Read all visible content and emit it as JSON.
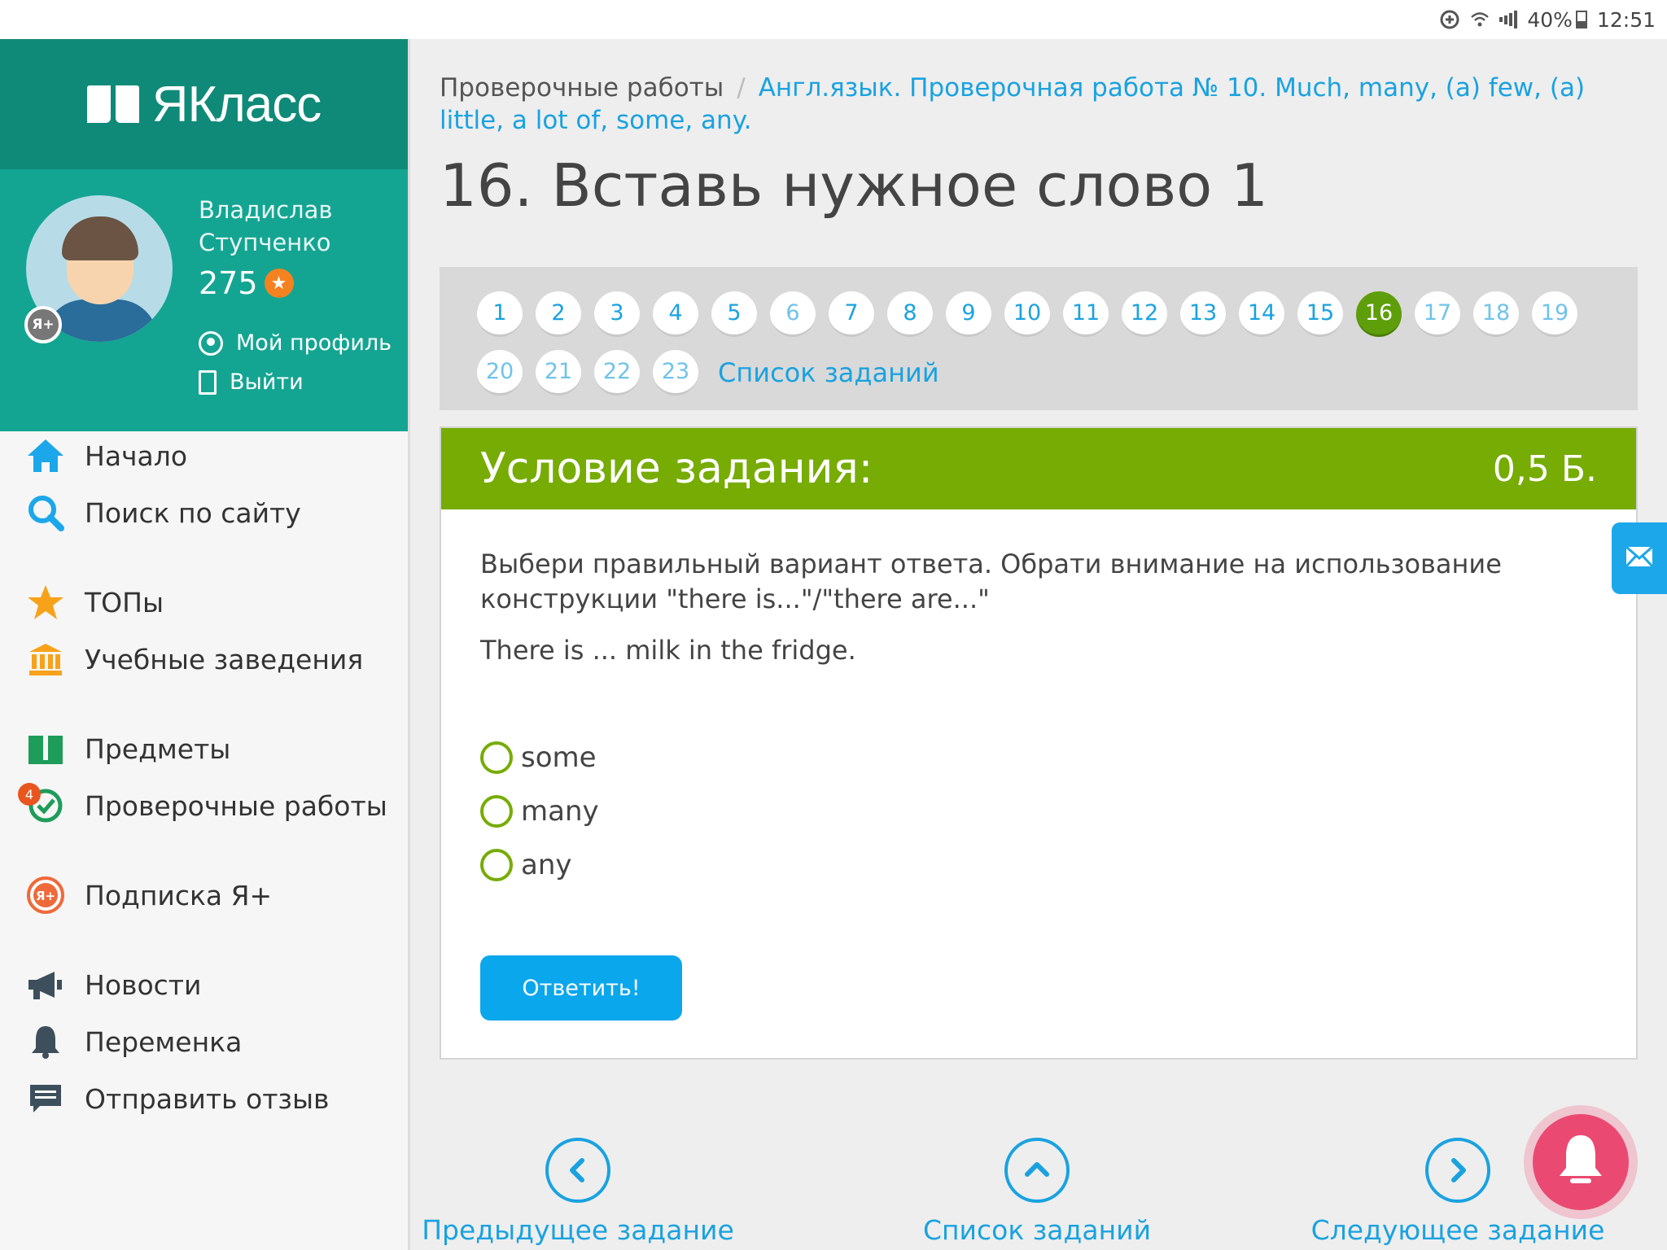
{
  "statusbar": {
    "battery": "40%",
    "time": "12:51"
  },
  "brand": {
    "name": "ЯКласс"
  },
  "profile": {
    "name": "Владислав Ступченко",
    "points": "275",
    "plus_badge": "Я+",
    "my_profile": "Мой профиль",
    "logout": "Выйти"
  },
  "nav": {
    "home": "Начало",
    "search": "Поиск по сайту",
    "tops": "ТОПы",
    "schools": "Учебные заведения",
    "subjects": "Предметы",
    "tests": "Проверочные работы",
    "tests_count": "4",
    "subscription": "Подписка Я+",
    "news": "Новости",
    "break": "Переменка",
    "feedback": "Отправить отзыв"
  },
  "breadcrumb": {
    "root": "Проверочные работы",
    "sep": "/",
    "current": "Англ.язык. Проверочная работа № 10. Much, many, (a) few, (a) little, a lot of, some, any."
  },
  "page": {
    "title": "16. Вставь нужное слово 1"
  },
  "tasks": {
    "row1": [
      "1",
      "2",
      "3",
      "4",
      "5",
      "6",
      "7",
      "8",
      "9",
      "10",
      "11",
      "12",
      "13",
      "14",
      "15",
      "16",
      "17",
      "18",
      "19"
    ],
    "row2": [
      "20",
      "21",
      "22",
      "23"
    ],
    "active": "16",
    "list_link": "Список заданий"
  },
  "task": {
    "header": "Условие задания:",
    "points": "0,5 Б.",
    "instruction": "Выбери правильный вариант ответа. Обрати внимание на использование конструкции \"there is...\"/\"there are...\"",
    "question": "There is ... milk in the fridge.",
    "options": [
      "some",
      "many",
      "any"
    ],
    "submit": "Ответить!"
  },
  "bottom": {
    "prev": "Предыдущее задание",
    "list": "Список заданий",
    "next": "Следующее задание"
  },
  "colors": {
    "brand_dark": "#0f8a78",
    "brand": "#14a592",
    "header_green": "#76ac04",
    "active_task": "#5e9e0a",
    "link_blue": "#1aa2e0",
    "button_blue": "#0ba7ec",
    "bell_pink": "#ea4a72"
  }
}
